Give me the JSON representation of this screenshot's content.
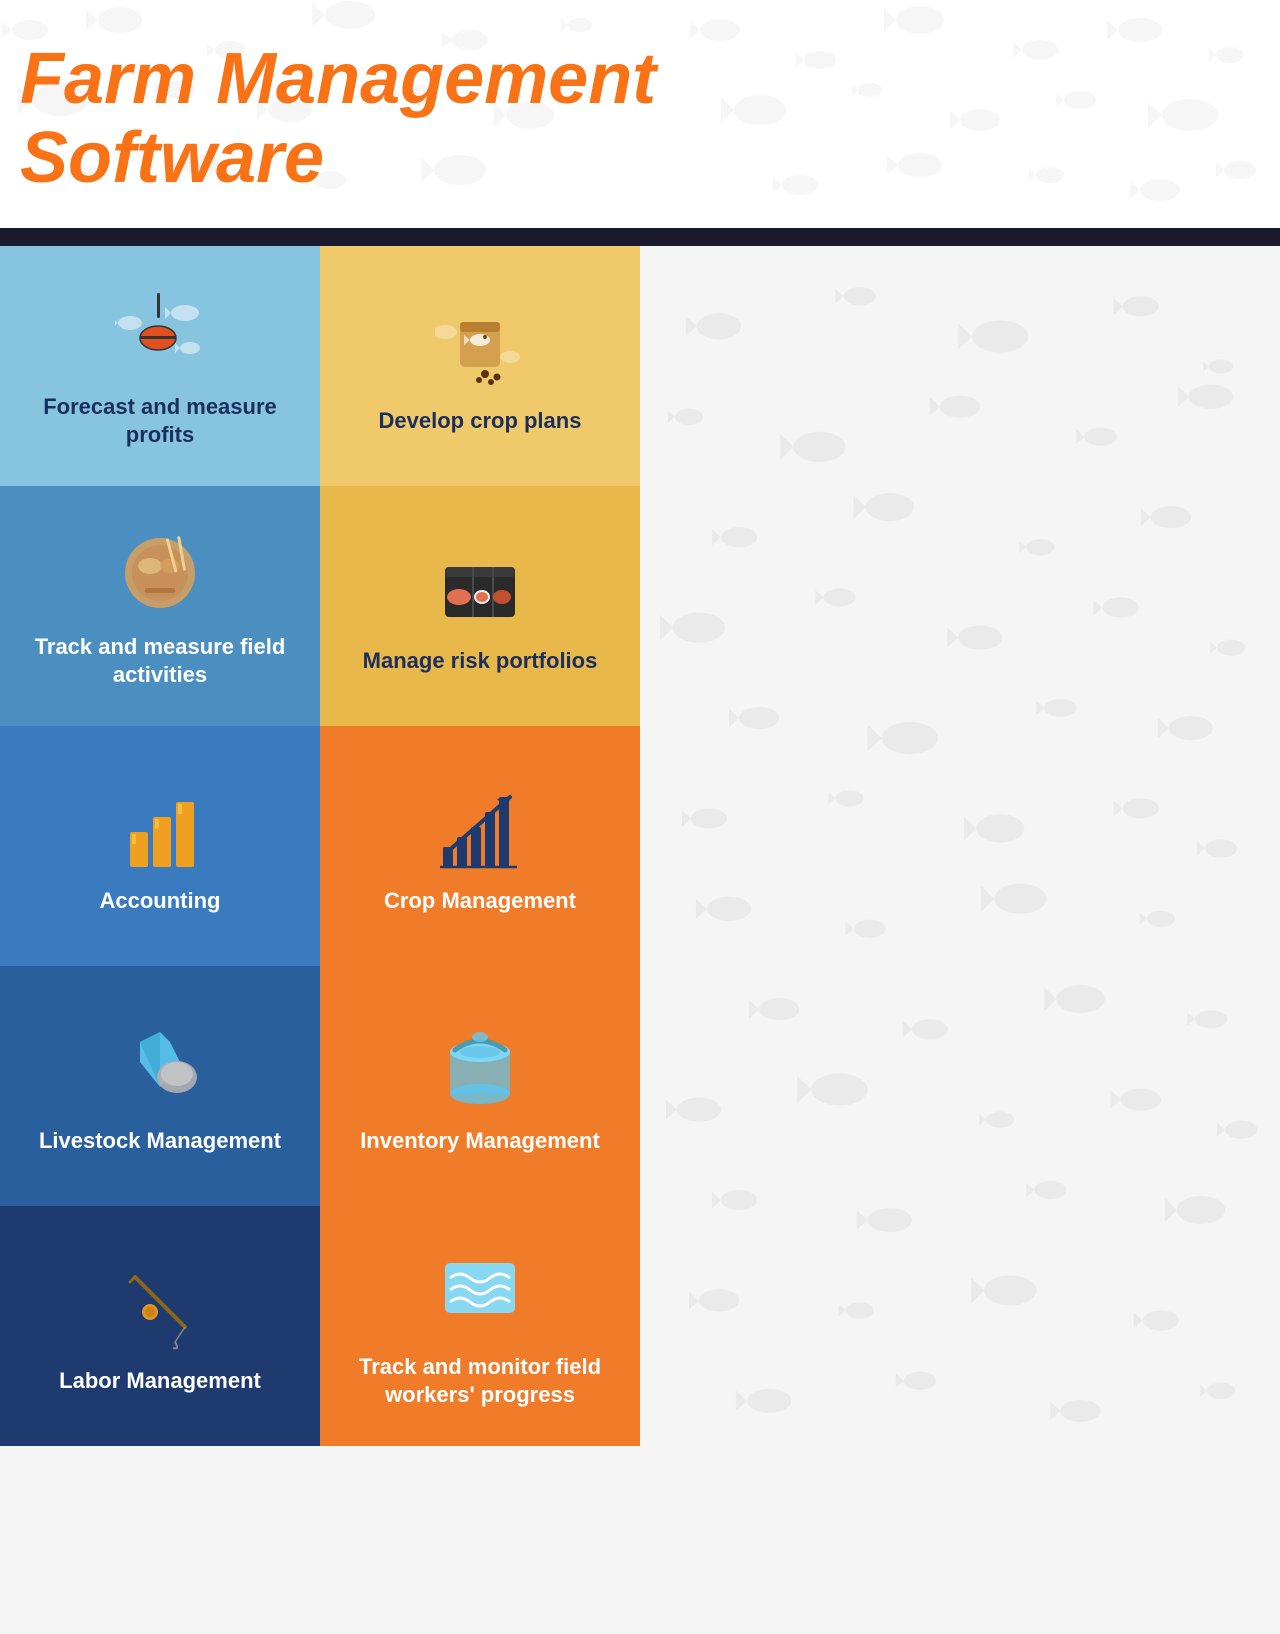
{
  "header": {
    "title_line1": "Farm Management",
    "title_line2": "Software"
  },
  "grid": {
    "cells": [
      {
        "id": "forecast",
        "label": "Forecast and measure profits",
        "bg_color": "#87c4e0",
        "label_color": "#1a2f5e",
        "icon_type": "fishing",
        "col": "left",
        "row": 1
      },
      {
        "id": "crop-plans",
        "label": "Develop crop plans",
        "bg_color": "#f0c96b",
        "label_color": "#1a2f5e",
        "icon_type": "seed-bag",
        "col": "right",
        "row": 1
      },
      {
        "id": "field-activities",
        "label": "Track and measure field activities",
        "bg_color": "#4a8fc0",
        "label_color": "#ffffff",
        "icon_type": "food-plate",
        "col": "left",
        "row": 2
      },
      {
        "id": "risk-portfolios",
        "label": "Manage risk portfolios",
        "bg_color": "#e8b84b",
        "label_color": "#1a2f5e",
        "icon_type": "sushi",
        "col": "right",
        "row": 2
      },
      {
        "id": "accounting",
        "label": "Accounting",
        "bg_color": "#3a7abf",
        "label_color": "#ffffff",
        "icon_type": "bar-chart",
        "col": "left",
        "row": 3
      },
      {
        "id": "crop-management",
        "label": "Crop Management",
        "bg_color": "#f07b28",
        "label_color": "#ffffff",
        "icon_type": "trending-chart",
        "col": "right",
        "row": 3
      },
      {
        "id": "livestock",
        "label": "Livestock Management",
        "bg_color": "#2a5f9e",
        "label_color": "#ffffff",
        "icon_type": "livestock",
        "col": "left",
        "row": 4
      },
      {
        "id": "inventory",
        "label": "Inventory Management",
        "bg_color": "#f07b28",
        "label_color": "#ffffff",
        "icon_type": "bucket",
        "col": "right",
        "row": 4
      },
      {
        "id": "labor",
        "label": "Labor Management",
        "bg_color": "#1e3a6e",
        "label_color": "#ffffff",
        "icon_type": "fishing-rod",
        "col": "left",
        "row": 5
      },
      {
        "id": "field-workers",
        "label": "Track and monitor field workers' progress",
        "bg_color": "#f07b28",
        "label_color": "#ffffff",
        "icon_type": "water-waves",
        "col": "right",
        "row": 5
      }
    ]
  }
}
